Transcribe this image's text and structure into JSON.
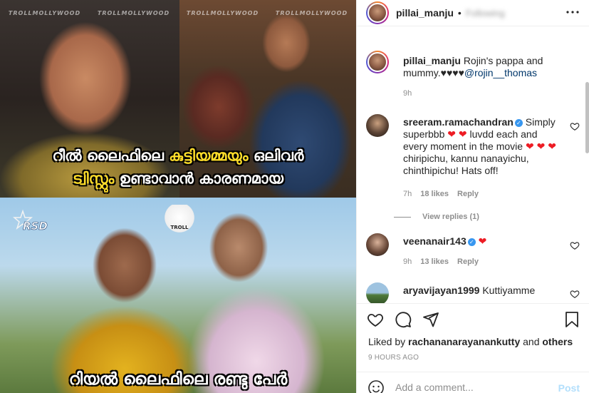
{
  "media": {
    "watermark": "TROLLMOLLYWOOD",
    "caption_top_line1_a": "റീൽ ലൈഫിലെ ",
    "caption_top_line1_highlight": "കുട്ടിയമ്മയും",
    "caption_top_line1_b": " ഒലിവർ",
    "caption_top_line2_a": "ട്വിസ്റ്റും ",
    "caption_top_line2_b": "ഉണ്ടാവാൻ കാരണമായ",
    "caption_bottom": "റിയൽ ലൈഫിലെ രണ്ടു പേർ",
    "rsd_logo": "RSD",
    "troll_logo_text": "TROLL"
  },
  "header": {
    "username": "pillai_manju",
    "dot": "•",
    "follow_text": "Following",
    "more_icon": "more-horizontal-icon"
  },
  "caption": {
    "username": "pillai_manju",
    "text": "Rojin's pappa and mummy.",
    "hearts": "♥♥♥♥",
    "mention": "@rojin__thomas",
    "time": "9h"
  },
  "comments": [
    {
      "username": "sreeram.ramachandran",
      "verified": true,
      "text_parts": [
        "Simply superbbb ",
        "❤ ❤",
        " luvdd each and every moment in the movie ",
        "❤",
        " ",
        "❤ ❤",
        " chiripichu, kannu nanayichu, chinthipichu! Hats off!"
      ],
      "time": "7h",
      "likes": "18 likes",
      "reply": "Reply",
      "view_replies": "View replies (1)"
    },
    {
      "username": "veenanair143",
      "verified": true,
      "hearts": "❤",
      "time": "9h",
      "likes": "13 likes",
      "reply": "Reply"
    },
    {
      "username": "aryavijayan1999",
      "text": "Kuttiyamme"
    }
  ],
  "actions": {
    "like_icon": "heart-outline-icon",
    "comment_icon": "comment-icon",
    "share_icon": "share-icon",
    "save_icon": "bookmark-icon",
    "liked_by_prefix": "Liked by ",
    "liked_by_user": "rachananarayanankutty",
    "liked_by_and": " and ",
    "liked_by_others": "others",
    "timestamp": "9 HOURS AGO"
  },
  "add_comment": {
    "placeholder": "Add a comment...",
    "post_label": "Post",
    "emoji_icon": "smiley-icon"
  }
}
